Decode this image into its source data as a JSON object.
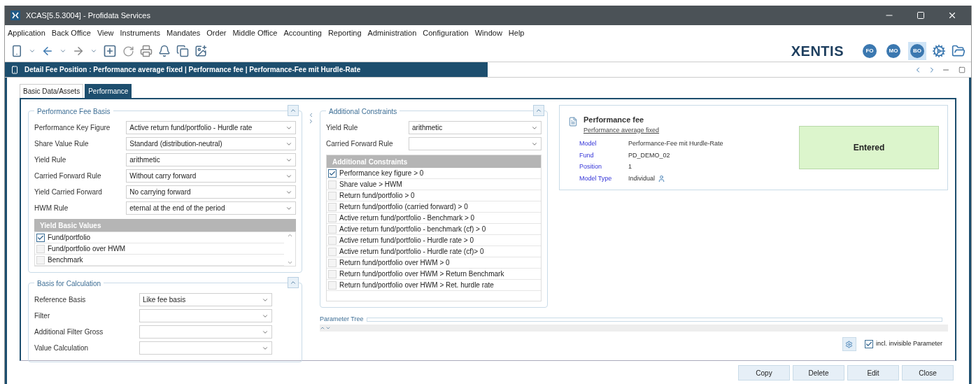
{
  "window": {
    "title": "XCAS[5.5.3004] - Profidata Services"
  },
  "menu": [
    "Application",
    "Back Office",
    "View",
    "Instruments",
    "Mandates",
    "Order",
    "Middle Office",
    "Accounting",
    "Reporting",
    "Administration",
    "Configuration",
    "Window",
    "Help"
  ],
  "brand": "XENTIS",
  "role_badges": [
    {
      "label": "FO",
      "selected": false
    },
    {
      "label": "MO",
      "selected": false
    },
    {
      "label": "BO",
      "selected": true
    }
  ],
  "document": {
    "title": "Detail Fee Position : Performance average fixed | Performance fee | Performance-Fee mit Hurdle-Rate"
  },
  "tabs": [
    {
      "label": "Basic Data/Assets",
      "selected": false
    },
    {
      "label": "Performance",
      "selected": true
    }
  ],
  "performance_fee_basis": {
    "title": "Performance Fee Basis",
    "fields": [
      {
        "label": "Performance Key Figure",
        "value": "Active return fund/portfolio - Hurdle rate"
      },
      {
        "label": "Share Value Rule",
        "value": "Standard (distribution-neutral)"
      },
      {
        "label": "Yield Rule",
        "value": "arithmetic"
      },
      {
        "label": "Carried Forward Rule",
        "value": "Without carry forward"
      },
      {
        "label": "Yield Carried Forward",
        "value": "No carrying forward"
      },
      {
        "label": "HWM Rule",
        "value": "eternal at the end of the period"
      }
    ],
    "yield_basic_values": {
      "title": "Yield Basic Values",
      "items": [
        {
          "label": "Fund/portfolio",
          "checked": true
        },
        {
          "label": "Fund/portfolio over HWM",
          "checked": false
        },
        {
          "label": "Benchmark",
          "checked": false
        }
      ]
    }
  },
  "basis_for_calculation": {
    "title": "Basis for Calculation",
    "fields": [
      {
        "label": "Reference Basis",
        "value": "Like fee basis"
      },
      {
        "label": "Filter"
      },
      {
        "label": "Additional Filter Gross"
      },
      {
        "label": "Value Calculation"
      }
    ]
  },
  "additional_constraints": {
    "title": "Additional Constraints",
    "fields": [
      {
        "label": "Yield Rule",
        "value": "arithmetic"
      },
      {
        "label": "Carried Forward Rule"
      }
    ],
    "list": {
      "title": "Additional Constraints",
      "items": [
        {
          "label": "Performance key figure > 0",
          "checked": true
        },
        {
          "label": "Share value > HWM",
          "checked": false
        },
        {
          "label": "Return fund/portfolio > 0",
          "checked": false
        },
        {
          "label": "Return fund/portfolio (carried forward) > 0",
          "checked": false
        },
        {
          "label": "Active return fund/portfolio - Benchmark > 0",
          "checked": false
        },
        {
          "label": "Active return fund/portfolio - benchmark (cf) > 0",
          "checked": false
        },
        {
          "label": "Active return fund/portfolio - Hurdle rate > 0",
          "checked": false
        },
        {
          "label": "Active return fund/portfolio - Hurdle rate (cf)> 0",
          "checked": false
        },
        {
          "label": "Return fund/portfolio over HWM > 0",
          "checked": false
        },
        {
          "label": "Return fund/portfolio over HWM > Return Benchmark",
          "checked": false
        },
        {
          "label": "Return fund/portfolio over HWM > Ret. hurdle rate",
          "checked": false
        }
      ]
    }
  },
  "summary": {
    "title": "Performance fee",
    "subtitle": "Performance average fixed",
    "properties": [
      {
        "label": "Model",
        "value": "Performance-Fee mit Hurdle-Rate"
      },
      {
        "label": "Fund",
        "value": "PD_DEMO_02"
      },
      {
        "label": "Position",
        "value": "1"
      },
      {
        "label": "Model Type",
        "value": "Individual",
        "kind": "person"
      }
    ],
    "status": "Entered"
  },
  "parameter_tree": {
    "title": "Parameter Tree",
    "include_invisible": {
      "label": "incl. invisible Parameter",
      "checked": true
    }
  },
  "buttons": [
    "Copy",
    "Delete",
    "Edit",
    "Close"
  ]
}
